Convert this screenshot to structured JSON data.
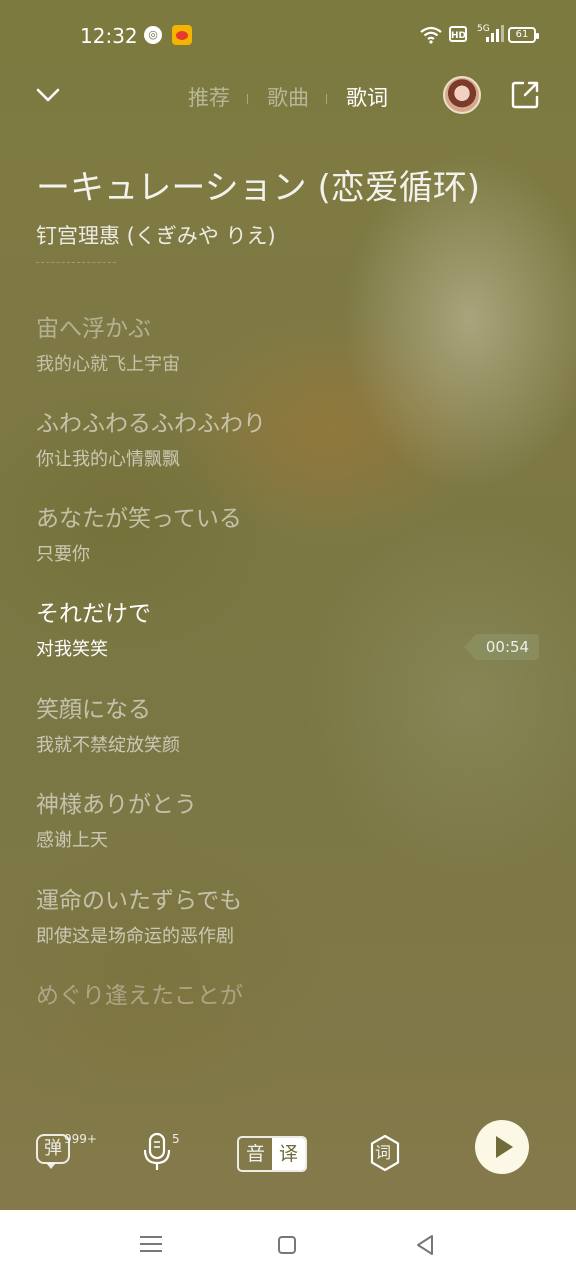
{
  "status_bar": {
    "time": "12:32",
    "network": "5G",
    "hd_label": "HD",
    "battery": "61"
  },
  "nav": {
    "tabs": [
      {
        "label": "推荐",
        "active": false
      },
      {
        "label": "歌曲",
        "active": false
      },
      {
        "label": "歌词",
        "active": true
      }
    ]
  },
  "song": {
    "title": "ーキュレーション (恋爱循环)",
    "artist": "钉宫理惠 (くぎみや りえ)"
  },
  "lyrics": [
    {
      "original": "宙へ浮かぶ",
      "translation": "我的心就飞上宇宙",
      "state": "top"
    },
    {
      "original": "ふわふわるふわふわり",
      "translation": "你让我的心情飘飘",
      "state": "normal"
    },
    {
      "original": "あなたが笑っている",
      "translation": "只要你",
      "state": "normal"
    },
    {
      "original": "それだけで",
      "translation": "对我笑笑",
      "state": "active"
    },
    {
      "original": "笑顔になる",
      "translation": "我就不禁绽放笑颜",
      "state": "normal"
    },
    {
      "original": "神様ありがとう",
      "translation": "感谢上天",
      "state": "normal"
    },
    {
      "original": "運命のいたずらでも",
      "translation": "即使这是场命运的恶作剧",
      "state": "normal"
    },
    {
      "original": "めぐり逢えたことが",
      "translation": "",
      "state": "fade"
    }
  ],
  "current_time": "00:54",
  "toolbar": {
    "danmu_label": "弹",
    "danmu_count": "999+",
    "sing_count": "5",
    "toggle_left": "音",
    "toggle_right": "译",
    "lyrics_icon_label": "词"
  },
  "colors": {
    "background": "#7d7a40",
    "active_lyric": "#ffffff",
    "play_button": "#fbf8e6"
  },
  "icons": [
    "chevron-down-icon",
    "share-icon",
    "mic-icon",
    "play-icon",
    "lyrics-icon"
  ]
}
